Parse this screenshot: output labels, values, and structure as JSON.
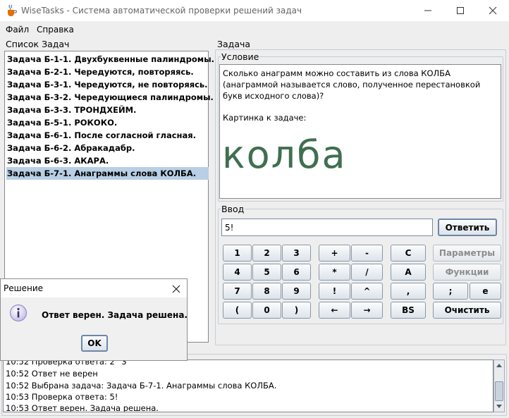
{
  "window": {
    "title": "WiseTasks - Система автоматической проверки решений задач"
  },
  "menu": [
    "Файл",
    "Справка"
  ],
  "task_list": {
    "label": "Список Задач",
    "items": [
      "Задача Б-1-1. Двухбуквенные палиндромы.",
      "Задача Б-2-1. Чередуются, повторяясь.",
      "Задача Б-3-1. Чередуются, не повторяясь.",
      "Задача Б-3-2. Чередующиеся палиндромы.",
      "Задача Б-3-3. ТРОНДХЕЙМ.",
      "Задача Б-5-1. РОКОКО.",
      "Задача Б-6-1. После согласной гласная.",
      "Задача Б-6-2. Абракадабр.",
      "Задача Б-6-3. АКАРА.",
      "Задача Б-7-1. Анаграммы слова КОЛБА."
    ],
    "selected_index": 9
  },
  "task": {
    "label": "Задача",
    "condition_label": "Условие",
    "condition_text": "Сколько анаграмм можно составить из слова КОЛБА (анаграммой называется слово, полученное перестановкой букв исходного слова)?",
    "picture_caption": "Картинка к задаче:",
    "picture_word": "колба"
  },
  "input": {
    "label": "Ввод",
    "value": "5!",
    "submit_label": "Ответить"
  },
  "keypad": {
    "digits": [
      [
        "1",
        "2",
        "3"
      ],
      [
        "4",
        "5",
        "6"
      ],
      [
        "7",
        "8",
        "9"
      ],
      [
        "(",
        "0",
        ")"
      ]
    ],
    "ops": [
      [
        "+",
        "-"
      ],
      [
        "*",
        "/"
      ],
      [
        "!",
        "^"
      ],
      [
        "←",
        "→"
      ]
    ],
    "edit": [
      "C",
      "A",
      ",",
      "BS"
    ],
    "params_label": "Параметры",
    "functions_label": "Функции",
    "semicolon": ";",
    "e": "e",
    "clear_label": "Очистить"
  },
  "log": [
    "10:52 Проверка ответа: 2^3",
    "10:52 Ответ не верен",
    "10:52 Выбрана задача: Задача Б-7-1. Анаграммы слова КОЛБА.",
    "10:53 Проверка ответа: 5!",
    "10:53 Ответ верен. Задача решена."
  ],
  "dialog": {
    "title": "Решение",
    "message": "Ответ верен. Задача решена.",
    "ok_label": "OK",
    "icon": "info-icon"
  }
}
